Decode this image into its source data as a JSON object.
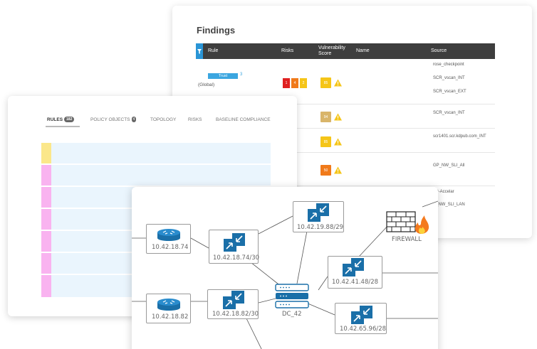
{
  "findings": {
    "title": "Findings",
    "columns": [
      "Rule",
      "Risks",
      "Vulnerability Score",
      "Name",
      "Source"
    ],
    "rows": [
      {
        "rule_badge": "Trust",
        "rule_count": "3",
        "rule_scope": "(Global)",
        "risks": [
          {
            "value": "1",
            "color": "#e02020"
          },
          {
            "value": "4",
            "color": "#f07a1a"
          },
          {
            "value": "2",
            "color": "#f5c518"
          }
        ],
        "vscore": "85",
        "vscore_color": "#f5c518",
        "sources": [
          "rose_checkpoint",
          "SCR_vscan_INT",
          "SCR_vscan_EXT"
        ]
      },
      {
        "vscore": "94",
        "vscore_color": "#d9b56a",
        "sources": [
          "SCR_vscan_INT"
        ]
      },
      {
        "vscore": "85",
        "vscore_color": "#f5c518",
        "sources": [
          "scr1401.scr.kdpub.com_INT"
        ]
      },
      {
        "vscore": "50",
        "vscore_color": "#f07a1a",
        "sources": [
          "GP_NW_SLI_All"
        ]
      },
      {
        "sources": [
          "TP-Accelar",
          "P_NW_SLI_LAN"
        ]
      }
    ]
  },
  "policy": {
    "tabs": [
      {
        "label": "RULES",
        "badge": "182",
        "active": true
      },
      {
        "label": "POLICY OBJECTS",
        "badge": "4"
      },
      {
        "label": "TOPOLOGY"
      },
      {
        "label": "RISKS"
      },
      {
        "label": "BASELINE COMPLIANCE"
      }
    ],
    "row_stripes": [
      "#fbe78a",
      "#f9b3f0",
      "#f9b3f0",
      "#f9b3f0",
      "#f9b3f0",
      "#f9b3f0",
      "#f9b3f0"
    ]
  },
  "topology": {
    "routers": [
      {
        "label": "10.42.18.74"
      },
      {
        "label": "10.42.18.82"
      }
    ],
    "networks": [
      {
        "label": "10.42.18.74/30"
      },
      {
        "label": "10.42.18.82/30"
      },
      {
        "label": "10.42.19.88/29"
      },
      {
        "label": "10.42.41.48/28"
      },
      {
        "label": "10.42.65.96/28"
      }
    ],
    "device": {
      "label": "DC_42"
    },
    "firewall": {
      "label": "FIREWALL"
    }
  }
}
